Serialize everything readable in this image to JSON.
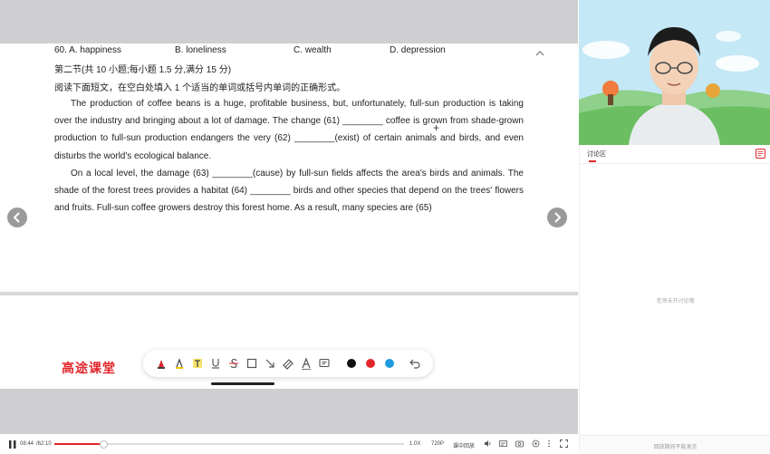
{
  "document": {
    "options": [
      "60. A. happiness",
      "B. loneliness",
      "C. wealth",
      "D. depression"
    ],
    "section_title": "第二节(共 10 小题;每小题 1.5 分,满分 15 分)",
    "instruction": "阅读下面短文，在空白处填入 1 个适当的单词或括号内单词的正确形式。",
    "paragraph1": "The production of coffee beans is a huge, profitable business, but, unfortunately, full-sun production is taking over the industry and bringing about a lot of damage. The change (61) ________ coffee is grown from shade-grown production to full-sun production endangers the very (62) ________(exist) of certain animals and birds, and even disturbs the world's ecological balance.",
    "paragraph2": "On a local level, the damage (63) ________(cause) by full-sun fields affects the area's birds and animals. The shade of the forest trees provides a habitat (64) ________ birds and other species that depend on the trees' flowers and fruits. Full-sun coffee growers destroy this forest home. As a result, many species are (65)"
  },
  "brand": {
    "logo_text": "高途课堂",
    "color": "#e2262b"
  },
  "toolbar": {
    "icons": [
      "pen-icon",
      "highlighter-icon",
      "text-icon",
      "underline-icon",
      "strikethrough-icon",
      "rectangle-icon",
      "arrow-icon",
      "eraser-icon",
      "text-style-icon",
      "comment-icon",
      "undo-icon"
    ],
    "colors": [
      "#111111",
      "#e2262b",
      "#1e9be0"
    ]
  },
  "player": {
    "current_time": "08:44",
    "total_time": "/62:10",
    "progress": 0.14,
    "speed": "1.0X",
    "quality": "720P",
    "mode": "课中回放"
  },
  "panel": {
    "tab_label": "讨论区",
    "empty_text": "老师未开讨论哦",
    "bottom_text": "回放期间不能发言"
  }
}
